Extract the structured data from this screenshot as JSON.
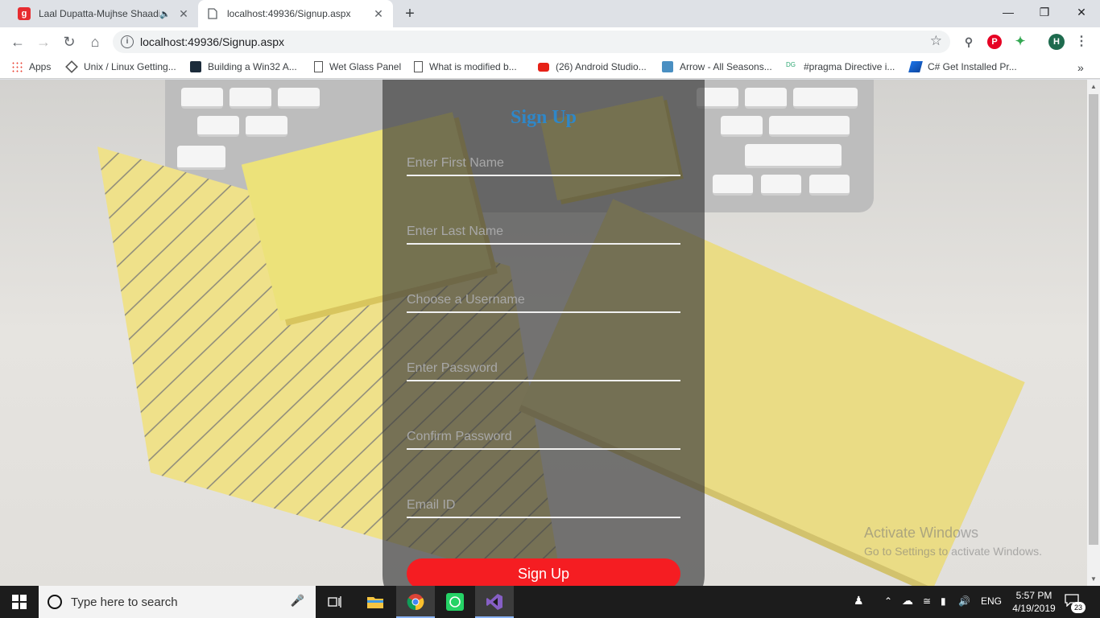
{
  "browser": {
    "tabs": [
      {
        "title": "Laal Dupatta-Mujhse Shaadi",
        "icon": "gaana-icon"
      },
      {
        "title": "localhost:49936/Signup.aspx",
        "icon": "page-icon"
      }
    ],
    "url": "localhost:49936/Signup.aspx",
    "profile_initial": "H",
    "bookmarks": [
      {
        "label": "Apps",
        "icon": "apps-grid-icon"
      },
      {
        "label": "Unix / Linux Getting...",
        "icon": "diamond-icon"
      },
      {
        "label": "Building a Win32 A...",
        "icon": "monitor-icon"
      },
      {
        "label": "Wet Glass Panel",
        "icon": "page-icon"
      },
      {
        "label": "What is modified b...",
        "icon": "page-icon"
      },
      {
        "label": "(26) Android Studio...",
        "icon": "youtube-icon"
      },
      {
        "label": "Arrow - All Seasons...",
        "icon": "arrow-site-icon"
      },
      {
        "label": "#pragma Directive i...",
        "icon": "dg-icon"
      },
      {
        "label": "C# Get Installed Pr...",
        "icon": "cs-icon"
      }
    ]
  },
  "form": {
    "title": "Sign Up",
    "fields": [
      {
        "placeholder": "Enter First Name",
        "value": ""
      },
      {
        "placeholder": "Enter Last Name",
        "value": ""
      },
      {
        "placeholder": "Choose a Username",
        "value": ""
      },
      {
        "placeholder": "Enter Password",
        "value": ""
      },
      {
        "placeholder": "Confirm Password",
        "value": ""
      },
      {
        "placeholder": "Email ID",
        "value": ""
      }
    ],
    "submit_label": "Sign Up"
  },
  "watermark": {
    "line1": "Activate Windows",
    "line2": "Go to Settings to activate Windows."
  },
  "taskbar": {
    "search_placeholder": "Type here to search",
    "language": "ENG",
    "time": "5:57 PM",
    "date": "4/19/2019",
    "notification_count": "23"
  },
  "colors": {
    "title_blue": "#2f87c8",
    "submit_red": "#f51d22",
    "panel_overlay": "rgba(60,60,60,0.68)",
    "taskbar_bg": "#1c1c1c"
  }
}
